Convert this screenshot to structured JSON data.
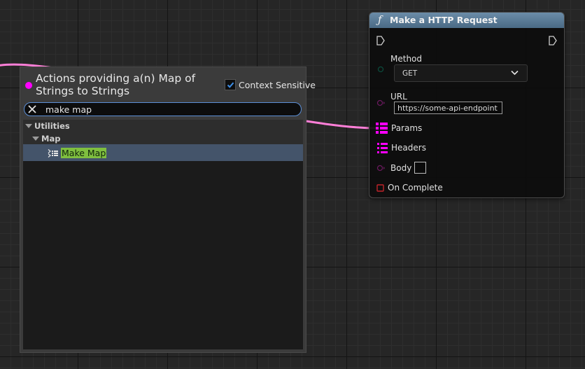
{
  "action_menu": {
    "title": "Actions providing a(n) Map of Strings to Strings",
    "context_sensitive_label": "Context Sensitive",
    "context_sensitive_checked": true,
    "search": {
      "value": "make map",
      "placeholder": ""
    },
    "tree": {
      "category": "Utilities",
      "subcategory": "Map",
      "selected_item": "Make Map"
    }
  },
  "http_node": {
    "title": "Make a HTTP Request",
    "icon": "function-icon",
    "pins": {
      "method": {
        "label": "Method",
        "value": "GET"
      },
      "url": {
        "label": "URL",
        "value": "https://some-api-endpoint"
      },
      "params": {
        "label": "Params"
      },
      "headers": {
        "label": "Headers"
      },
      "body": {
        "label": "Body"
      },
      "on_complete": {
        "label": "On Complete"
      }
    }
  },
  "colors": {
    "map_pin": "#ff00ff",
    "wire": "#ff7fd8",
    "selected_row": "#44546a",
    "highlight": "#7fbf3f",
    "node_header": "#5a7a96",
    "search_border": "#5c8fd6"
  }
}
